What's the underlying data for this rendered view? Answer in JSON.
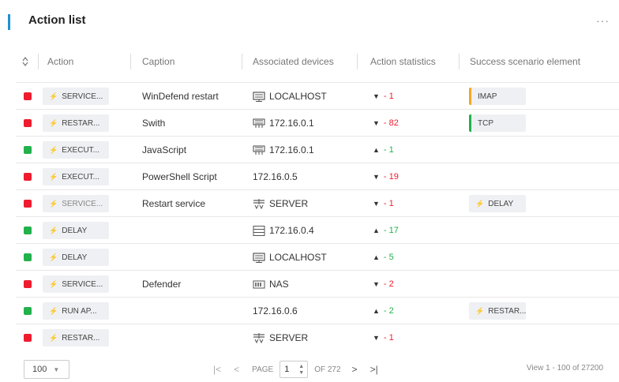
{
  "header": {
    "title": "Action list",
    "more_label": "···"
  },
  "table": {
    "columns": [
      "Action",
      "Caption",
      "Associated devices",
      "Action statistics",
      "Success scenario element"
    ],
    "rows": [
      {
        "status": "red",
        "action": "SERVICE...",
        "action_active": true,
        "caption": "WinDefend restart",
        "device_icon": "monitor-icon",
        "device": "LOCALHOST",
        "trend": "down",
        "stat": "1",
        "stat_color": "red",
        "success": "IMAP",
        "success_bar": "orange",
        "success_bolt": false
      },
      {
        "status": "red",
        "action": "RESTAR...",
        "action_active": true,
        "caption": "Swith",
        "device_icon": "network-switch-icon",
        "device": "172.16.0.1",
        "trend": "down",
        "stat": "82",
        "stat_color": "red",
        "success": "TCP",
        "success_bar": "green",
        "success_bolt": false
      },
      {
        "status": "green",
        "action": "EXECUT...",
        "action_active": true,
        "caption": "JavaScript",
        "device_icon": "network-switch-icon",
        "device": "172.16.0.1",
        "trend": "up",
        "stat": "1",
        "stat_color": "green",
        "success": "",
        "success_bar": "",
        "success_bolt": false
      },
      {
        "status": "red",
        "action": "EXECUT...",
        "action_active": true,
        "caption": "PowerShell Script",
        "device_icon": "",
        "device": "172.16.0.5",
        "trend": "down",
        "stat": "19",
        "stat_color": "red",
        "success": "",
        "success_bar": "",
        "success_bolt": false
      },
      {
        "status": "red",
        "action": "SERVICE...",
        "action_active": false,
        "caption": "Restart service",
        "device_icon": "server-icon",
        "device": "SERVER",
        "trend": "down",
        "stat": "1",
        "stat_color": "red",
        "success": "DELAY",
        "success_bar": "",
        "success_bolt": true,
        "success_bolt_color": "green"
      },
      {
        "status": "green",
        "action": "DELAY",
        "action_active": true,
        "action_bolt_color": "green",
        "caption": "",
        "device_icon": "rack-icon",
        "device": "172.16.0.4",
        "trend": "up",
        "stat": "17",
        "stat_color": "green",
        "success": "",
        "success_bar": "",
        "success_bolt": false
      },
      {
        "status": "green",
        "action": "DELAY",
        "action_active": true,
        "action_bolt_color": "green",
        "caption": "",
        "device_icon": "monitor-icon",
        "device": "LOCALHOST",
        "trend": "up",
        "stat": "5",
        "stat_color": "green",
        "success": "",
        "success_bar": "",
        "success_bolt": false
      },
      {
        "status": "red",
        "action": "SERVICE...",
        "action_active": true,
        "caption": "Defender",
        "device_icon": "nas-icon",
        "device": "NAS",
        "trend": "down",
        "stat": "2",
        "stat_color": "red",
        "success": "",
        "success_bar": "",
        "success_bolt": false
      },
      {
        "status": "green",
        "action": "RUN AP...",
        "action_active": true,
        "action_bolt_color": "green",
        "caption": "",
        "device_icon": "",
        "device": "172.16.0.6",
        "trend": "up",
        "stat": "2",
        "stat_color": "green",
        "success": "RESTAR...",
        "success_bar": "",
        "success_bolt": true,
        "success_bolt_color": "red"
      },
      {
        "status": "red",
        "action": "RESTAR...",
        "action_active": true,
        "caption": "",
        "device_icon": "server-icon",
        "device": "SERVER",
        "trend": "down",
        "stat": "1",
        "stat_color": "red",
        "success": "",
        "success_bar": "",
        "success_bolt": false
      }
    ]
  },
  "footer": {
    "page_size": "100",
    "page_label": "PAGE",
    "page_value": "1",
    "of_label": "OF 272",
    "view_info": "View 1 - 100 of 27200"
  },
  "colors": {
    "accent": "#1e90d6",
    "red": "#ee1c2e",
    "green": "#22b14c",
    "orange": "#f5a623"
  }
}
